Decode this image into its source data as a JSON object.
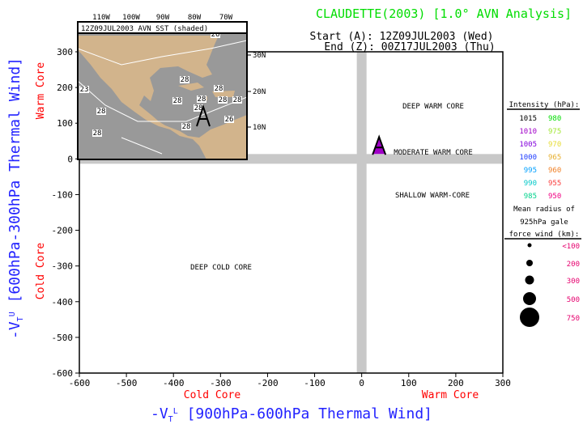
{
  "title": "CLAUDETTE(2003) [1.0° AVN Analysis]",
  "start_label": "Start (A): 12Z09JUL2003 (Wed)",
  "end_label": "End (Z): 00Z17JUL2003 (Thu)",
  "colors": {
    "title": "#00dd00",
    "axis_title": "#2222ff",
    "core_label": "#ff0000",
    "band": "#c8c8c8",
    "land": "#d2b48c",
    "sea": "#999999"
  },
  "inset": {
    "title": "12Z09JUL2003 AVN SST (shaded)",
    "lon_ticks": [
      "110W",
      "100W",
      "90W",
      "80W",
      "70W"
    ],
    "lat_ticks": [
      "30N",
      "20N",
      "10N"
    ],
    "contour_labels": [
      "23",
      "28",
      "28",
      "28",
      "28",
      "28",
      "28",
      "28",
      "28",
      "28",
      "28",
      "26",
      "26"
    ],
    "track_marker": "A"
  },
  "chart_data": {
    "type": "scatter",
    "xlabel": "-VT L [900hPa-600hPa Thermal Wind]",
    "xlabel_main": "-V",
    "xlabel_sub": "T",
    "xlabel_sup": "L",
    "xlabel_rest": " [900hPa-600hPa Thermal Wind]",
    "ylabel_main": "-V",
    "ylabel_sub": "T",
    "ylabel_sup": "U",
    "ylabel_rest": " [600hPa-300hPa Thermal Wind]",
    "xlim": [
      -600,
      300
    ],
    "ylim": [
      -600,
      300
    ],
    "xticks": [
      -600,
      -500,
      -400,
      -300,
      -200,
      -100,
      0,
      100,
      200,
      300
    ],
    "yticks": [
      -600,
      -500,
      -400,
      -300,
      -200,
      -100,
      0,
      100,
      200,
      300
    ],
    "x_core_labels": {
      "left": "Cold Core",
      "right": "Warm Core"
    },
    "y_core_labels": {
      "top": "Warm Core",
      "bottom": "Cold Core"
    },
    "quadrant_labels": [
      "DEEP WARM CORE",
      "MODERATE WARM CORE",
      "SHALLOW WARM-CORE",
      "DEEP COLD CORE"
    ],
    "points": [
      {
        "label": "A",
        "x": 37,
        "y": 32,
        "intensity_hpa": 1010,
        "color": "#a000c8"
      }
    ]
  },
  "legend": {
    "intensity_title": "Intensity (hPa):",
    "intensity": [
      [
        {
          "v": "1015",
          "c": "#000000"
        },
        {
          "v": "980",
          "c": "#00dc00"
        }
      ],
      [
        {
          "v": "1010",
          "c": "#a000c8"
        },
        {
          "v": "975",
          "c": "#a0e632"
        }
      ],
      [
        {
          "v": "1005",
          "c": "#8200dc"
        },
        {
          "v": "970",
          "c": "#e6dc32"
        }
      ],
      [
        {
          "v": "1000",
          "c": "#1e3cff"
        },
        {
          "v": "965",
          "c": "#e6af2d"
        }
      ],
      [
        {
          "v": "995",
          "c": "#00a0ff"
        },
        {
          "v": "960",
          "c": "#f08228"
        }
      ],
      [
        {
          "v": "990",
          "c": "#00c8c8"
        },
        {
          "v": "955",
          "c": "#fa3c3c"
        }
      ],
      [
        {
          "v": "985",
          "c": "#00d28c"
        },
        {
          "v": "950",
          "c": "#f00082"
        }
      ]
    ],
    "radius_title_1": "Mean radius of",
    "radius_title_2": "925hPa gale",
    "radius_title_3": "force wind (km):",
    "radius_color": "#e6006e",
    "radius": [
      "<100",
      "200",
      "300",
      "500",
      "750"
    ]
  }
}
